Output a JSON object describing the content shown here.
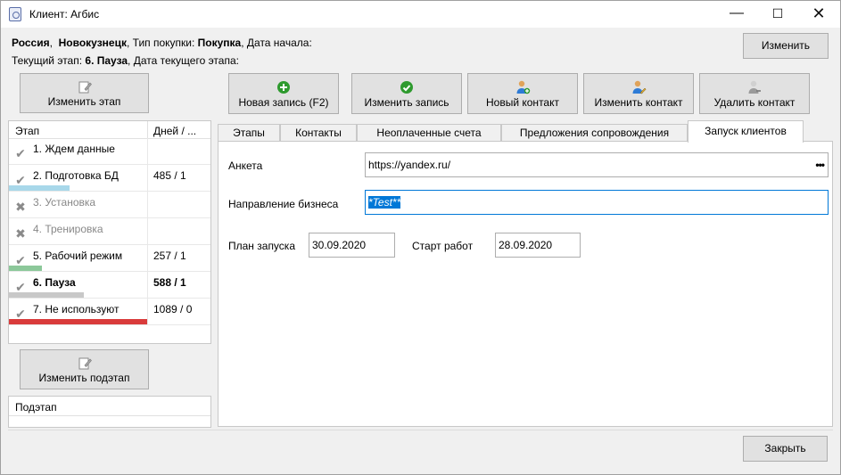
{
  "window": {
    "title": "Клиент: Агбис"
  },
  "info": {
    "country": "Россия",
    "comma1": ",",
    "city": "Новокузнецк",
    "purchase_type_label": ", Тип покупки:",
    "purchase_type": "Покупка",
    "start_date_label": ", Дата начала:",
    "current_stage_label": "Текущий этап:",
    "current_stage": "6. Пауза",
    "stage_date_label": ", Дата текущего этапа:"
  },
  "buttons": {
    "change_top": "Изменить",
    "change_stage": "Изменить этап",
    "change_substage": "Изменить подэтап",
    "close": "Закрыть"
  },
  "toolbar": [
    {
      "label": "Новая запись (F2)",
      "icon": "plus-circle-icon",
      "color": "#2e9a2e"
    },
    {
      "label": "Изменить запись",
      "icon": "check-circle-icon",
      "color": "#2e9a2e"
    },
    {
      "label": "Новый контакт",
      "icon": "user-add-icon",
      "color": "#2e7bd6"
    },
    {
      "label": "Изменить контакт",
      "icon": "user-edit-icon",
      "color": "#2e7bd6"
    },
    {
      "label": "Удалить контакт",
      "icon": "user-remove-icon",
      "color": "#9a9a9a"
    }
  ],
  "stages_table": {
    "headers": [
      "Этап",
      "Дней / ..."
    ],
    "rows": [
      {
        "name": "1. Ждем данные",
        "days": "",
        "mark": "check",
        "bar_color": "",
        "bar_fraction": 0
      },
      {
        "name": "2. Подготовка БД",
        "days": "485 / 1",
        "mark": "check",
        "bar_color": "#a8d8ea",
        "bar_fraction": 0.44
      },
      {
        "name": "3. Установка",
        "days": "",
        "mark": "cross",
        "bar_color": "",
        "bar_fraction": 0
      },
      {
        "name": "4. Тренировка",
        "days": "",
        "mark": "cross",
        "bar_color": "",
        "bar_fraction": 0
      },
      {
        "name": "5. Рабочий режим",
        "days": "257 / 1",
        "mark": "check",
        "bar_color": "#8cc89a",
        "bar_fraction": 0.24
      },
      {
        "name": "6. Пауза",
        "days": "588 / 1",
        "mark": "check",
        "bar_color": "#c8c8c8",
        "bar_fraction": 0.54
      },
      {
        "name": "7. Не используют",
        "days": "1089 / 0",
        "mark": "check",
        "bar_color": "#d93b3b",
        "bar_fraction": 1.0
      }
    ]
  },
  "substage_table": {
    "header": "Подэтап"
  },
  "tabs": [
    {
      "label": "Этапы",
      "active": false
    },
    {
      "label": "Контакты",
      "active": false
    },
    {
      "label": "Неоплаченные счета",
      "active": false
    },
    {
      "label": "Предложения сопровождения",
      "active": false
    },
    {
      "label": "Запуск клиентов",
      "active": true
    }
  ],
  "form": {
    "anketa_label": "Анкета",
    "anketa_value": "https://yandex.ru/",
    "anketa_more": "•••",
    "business_label": "Направление бизнеса",
    "business_value": "*Test**",
    "launch_plan_label": "План запуска",
    "launch_plan_value": "30.09.2020",
    "work_start_label": "Старт работ",
    "work_start_value": "28.09.2020"
  }
}
